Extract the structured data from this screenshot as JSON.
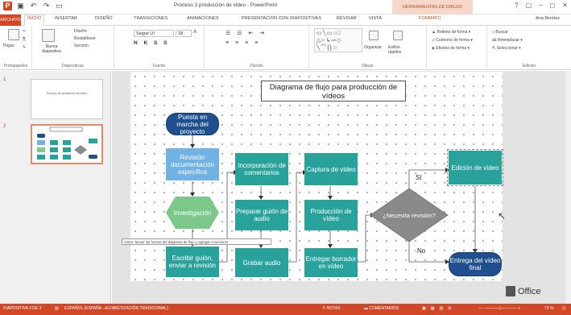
{
  "window": {
    "title": "Proceso 3 producción de video - PowerPoint",
    "context_group": "HERRAMIENTAS DE DIBUJO",
    "user": "Ana Benítez"
  },
  "quick_access": [
    "save-icon",
    "undo-icon",
    "redo-icon",
    "presentation-icon"
  ],
  "tabs": [
    "ARCHIVO",
    "INICIO",
    "INSERTAR",
    "DISEÑO",
    "TRANSICIONES",
    "ANIMACIONES",
    "PRESENTACIÓN CON DIAPOSITIVAS",
    "REVISAR",
    "VISTA",
    "FORMATO"
  ],
  "active_tab": "INICIO",
  "ribbon": {
    "groups": {
      "portapapeles": "Portapapeles",
      "diapositivas": "Diapositivas",
      "fuente": "Fuente",
      "parrafo": "Párrafo",
      "dibujo": "Dibujo",
      "edicion": "Edición"
    },
    "pegar": "Pegar",
    "nueva_diapositiva": "Nueva diapositiva",
    "diseno": "Diseño",
    "restablecer": "Restablecer",
    "seccion": "Sección",
    "font_name": "Segoe UI",
    "font_size": "18",
    "organizar": "Organizar",
    "estilos_rapidos": "Estilos rápidos",
    "relleno": "Relleno de forma",
    "contorno": "Contorno de forma",
    "efectos": "Efectos de forma",
    "buscar": "Buscar",
    "reemplazar": "Reemplazar",
    "seleccionar": "Seleccionar"
  },
  "slides_pane": {
    "slide1_number": "1",
    "slide1_title": "Proceso de producción de vídeo",
    "slide2_number": "2"
  },
  "flowchart": {
    "title": "Diagrama de flujo para producción de vídeos",
    "nodes": {
      "puesta": "Puesta en marcha del proyecto",
      "revision_doc": "Revisión documentación específica",
      "investigacion": "Investigación",
      "escribir": "Escribir guión, enviar a revisión",
      "incorporacion": "Incorporación de comentarios",
      "preparar": "Preparar guión de audio",
      "grabar": "Grabar audio",
      "captura": "Captura de vídeo",
      "produccion": "Producción de vídeo",
      "entregar": "Entregar borrador en vídeo",
      "necesita": "¿Necesita revisión?",
      "edicion": "Edición de vídeo",
      "entrega_final": "Entrega del vídeo final"
    },
    "label_si": "Sí",
    "label_no": "No"
  },
  "tooltip": "Vídeo: Mover las formas del diagrama de flujo y agregar conectores",
  "watermark": "Office",
  "status": {
    "slide": "DIAPOSITIVA 2 DE 3",
    "language": "ESPAÑOL (ESPAÑA - ALFABETIZACIÓN TRADICIONAL)",
    "notes": "NOTAS",
    "comments": "COMENTARIOS",
    "zoom": "73 %"
  },
  "colors": {
    "accent": "#d24726",
    "teal": "#2aa29c",
    "navy": "#1f4f8f",
    "lightblue": "#6fb2e3",
    "green": "#7cc88a",
    "diamond": "#8a8a8a"
  }
}
